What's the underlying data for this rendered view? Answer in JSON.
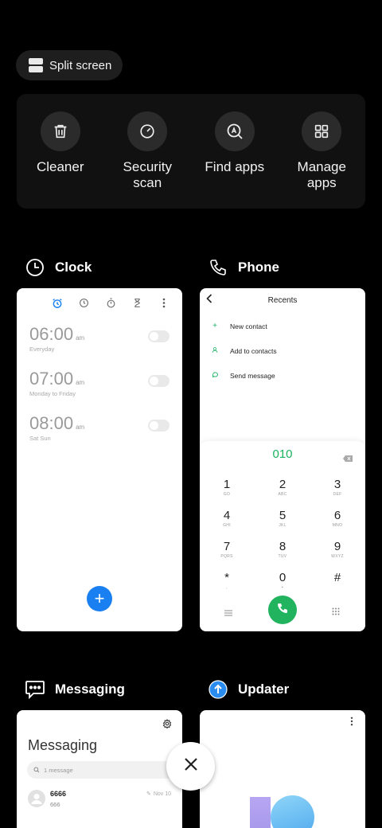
{
  "split_screen": {
    "label": "Split screen",
    "icon": "split-screen-icon"
  },
  "tools": [
    {
      "label": "Cleaner",
      "icon": "trash-icon"
    },
    {
      "label": "Security\nscan",
      "icon": "security-scan-icon"
    },
    {
      "label": "Find apps",
      "icon": "find-apps-icon"
    },
    {
      "label": "Manage\napps",
      "icon": "grid-icon"
    }
  ],
  "apps": {
    "clock": {
      "title": "Clock",
      "icon": "clock-icon",
      "tabs": [
        "alarm-icon",
        "world-clock-icon",
        "stopwatch-icon",
        "timer-icon",
        "more-icon"
      ],
      "alarms": [
        {
          "time": "06:00",
          "ampm": "am",
          "repeat": "Everyday"
        },
        {
          "time": "07:00",
          "ampm": "am",
          "repeat": "Monday to Friday"
        },
        {
          "time": "08:00",
          "ampm": "am",
          "repeat": "Sat Sun"
        }
      ],
      "add_label": "+"
    },
    "phone": {
      "title": "Phone",
      "icon": "phone-icon",
      "header": "Recents",
      "actions": [
        {
          "label": "New contact",
          "icon": "plus-icon"
        },
        {
          "label": "Add to contacts",
          "icon": "person-icon"
        },
        {
          "label": "Send message",
          "icon": "message-icon"
        }
      ],
      "dialed": "010",
      "keys": [
        {
          "d": "1",
          "l": "GO"
        },
        {
          "d": "2",
          "l": "ABC"
        },
        {
          "d": "3",
          "l": "DEF"
        },
        {
          "d": "4",
          "l": "GHI"
        },
        {
          "d": "5",
          "l": "JKL"
        },
        {
          "d": "6",
          "l": "MNO"
        },
        {
          "d": "7",
          "l": "PQRS"
        },
        {
          "d": "8",
          "l": "TUV"
        },
        {
          "d": "9",
          "l": "WXYZ"
        },
        {
          "d": "*",
          "l": ","
        },
        {
          "d": "0",
          "l": "+"
        },
        {
          "d": "#",
          "l": ""
        }
      ]
    },
    "messaging": {
      "title": "Messaging",
      "icon": "messaging-icon",
      "heading": "Messaging",
      "search_placeholder": "1 message",
      "thread": {
        "name": "6666",
        "preview": "666",
        "date": "Nov 10"
      }
    },
    "updater": {
      "title": "Updater",
      "icon": "updater-icon"
    }
  },
  "colors": {
    "accent_green": "#21b35e",
    "accent_blue": "#1a7ff0"
  }
}
